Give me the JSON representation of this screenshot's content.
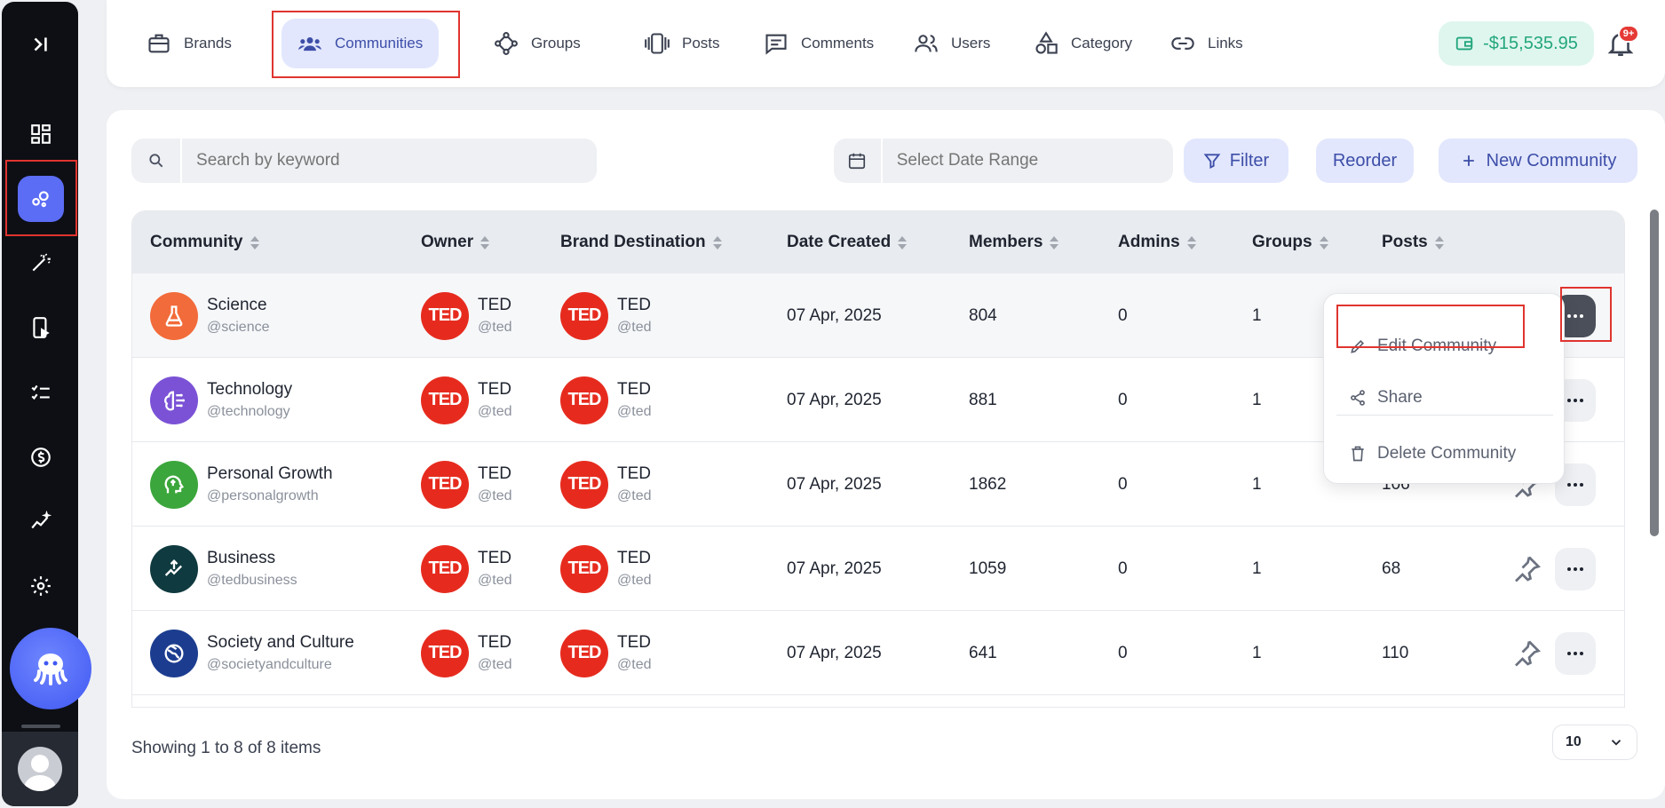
{
  "nav": {
    "items": [
      {
        "label": "Brands",
        "icon": "briefcase-icon"
      },
      {
        "label": "Communities",
        "icon": "communities-icon"
      },
      {
        "label": "Groups",
        "icon": "groups-icon"
      },
      {
        "label": "Posts",
        "icon": "posts-icon"
      },
      {
        "label": "Comments",
        "icon": "comments-icon"
      },
      {
        "label": "Users",
        "icon": "users-icon"
      },
      {
        "label": "Category",
        "icon": "category-icon"
      },
      {
        "label": "Links",
        "icon": "link-icon"
      }
    ],
    "active": "Communities",
    "balance": "-$15,535.95",
    "notifications_badge": "9+"
  },
  "toolbar": {
    "search_placeholder": "Search by keyword",
    "date_placeholder": "Select Date Range",
    "filter_label": "Filter",
    "reorder_label": "Reorder",
    "new_label": "New Community"
  },
  "table": {
    "columns": [
      "Community",
      "Owner",
      "Brand Destination",
      "Date Created",
      "Members",
      "Admins",
      "Groups",
      "Posts"
    ],
    "rows": [
      {
        "name": "Science",
        "handle": "@science",
        "owner": "TED",
        "owner_handle": "@ted",
        "brand": "TED",
        "brand_handle": "@ted",
        "date": "07 Apr, 2025",
        "members": "804",
        "admins": "0",
        "groups": "1",
        "posts": "",
        "icon_color": "#f26b3a",
        "icon": "flask-icon"
      },
      {
        "name": "Technology",
        "handle": "@technology",
        "owner": "TED",
        "owner_handle": "@ted",
        "brand": "TED",
        "brand_handle": "@ted",
        "date": "07 Apr, 2025",
        "members": "881",
        "admins": "0",
        "groups": "1",
        "posts": "",
        "icon_color": "#7b52d6",
        "icon": "brain-circuit-icon"
      },
      {
        "name": "Personal Growth",
        "handle": "@personalgrowth",
        "owner": "TED",
        "owner_handle": "@ted",
        "brand": "TED",
        "brand_handle": "@ted",
        "date": "07 Apr, 2025",
        "members": "1862",
        "admins": "0",
        "groups": "1",
        "posts": "106",
        "icon_color": "#3ba63b",
        "icon": "head-growth-icon"
      },
      {
        "name": "Business",
        "handle": "@tedbusiness",
        "owner": "TED",
        "owner_handle": "@ted",
        "brand": "TED",
        "brand_handle": "@ted",
        "date": "07 Apr, 2025",
        "members": "1059",
        "admins": "0",
        "groups": "1",
        "posts": "68",
        "icon_color": "#0f3a3f",
        "icon": "chart-growth-icon"
      },
      {
        "name": "Society and Culture",
        "handle": "@societyandculture",
        "owner": "TED",
        "owner_handle": "@ted",
        "brand": "TED",
        "brand_handle": "@ted",
        "date": "07 Apr, 2025",
        "members": "641",
        "admins": "0",
        "groups": "1",
        "posts": "110",
        "icon_color": "#1c3d8f",
        "icon": "globe-people-icon"
      }
    ]
  },
  "context_menu": {
    "edit": "Edit Community",
    "share": "Share",
    "delete": "Delete Community"
  },
  "footer": {
    "showing": "Showing 1 to 8 of 8 items",
    "page_size": "10"
  },
  "colors": {
    "accent": "#5b6cf5",
    "highlight": "#e0342f",
    "balance": "#22a67b",
    "ted_red": "#e62b1e"
  }
}
